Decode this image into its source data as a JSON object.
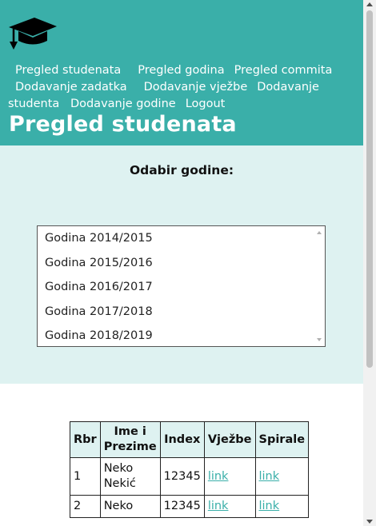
{
  "header": {
    "logo_icon": "graduation-cap-icon",
    "nav": [
      {
        "label": "Pregled studenata"
      },
      {
        "label": "Pregled godina"
      },
      {
        "label": "Pregled commita"
      },
      {
        "label": "Dodavanje zadatka"
      },
      {
        "label": "Dodavanje vježbe"
      },
      {
        "label": "Dodavanje studenta"
      },
      {
        "label": "Dodavanje godine"
      },
      {
        "label": "Logout"
      }
    ],
    "title": "Pregled studenata"
  },
  "year_select": {
    "label": "Odabir godine:",
    "options": [
      "Godina 2014/2015",
      "Godina 2015/2016",
      "Godina 2016/2017",
      "Godina 2017/2018",
      "Godina 2018/2019"
    ]
  },
  "students_table": {
    "headers": [
      "Rbr",
      "Ime i Prezime",
      "Index",
      "Vježbe",
      "Spirale"
    ],
    "rows": [
      {
        "rbr": "1",
        "name": "Neko Nekić",
        "index": "12345",
        "vjezbe": "link",
        "spirale": "link"
      },
      {
        "rbr": "2",
        "name": "Neko",
        "index": "12345",
        "vjezbe": "link",
        "spirale": "link"
      }
    ]
  },
  "colors": {
    "header_bg": "#3aafa9",
    "section_bg": "#def2f1",
    "link": "#3aafa9"
  }
}
